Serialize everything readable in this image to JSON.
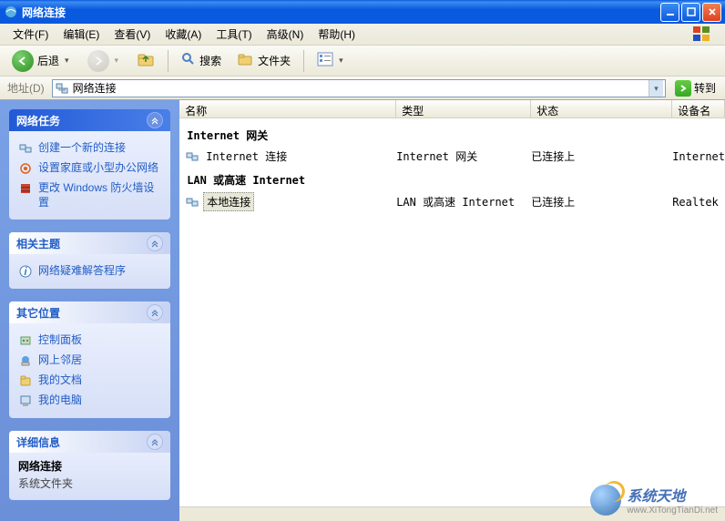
{
  "title": "网络连接",
  "menu": {
    "file": "文件(F)",
    "edit": "编辑(E)",
    "view": "查看(V)",
    "favorites": "收藏(A)",
    "tools": "工具(T)",
    "advanced": "高级(N)",
    "help": "帮助(H)"
  },
  "toolbar": {
    "back": "后退",
    "search": "搜索",
    "folders": "文件夹"
  },
  "address": {
    "label": "地址(D)",
    "value": "网络连接",
    "go": "转到"
  },
  "sidebar": {
    "tasks": {
      "title": "网络任务",
      "items": [
        "创建一个新的连接",
        "设置家庭或小型办公网络",
        "更改 Windows 防火墙设置"
      ]
    },
    "related": {
      "title": "相关主题",
      "items": [
        "网络疑难解答程序"
      ]
    },
    "places": {
      "title": "其它位置",
      "items": [
        "控制面板",
        "网上邻居",
        "我的文档",
        "我的电脑"
      ]
    },
    "details": {
      "title": "详细信息",
      "name": "网络连接",
      "type": "系统文件夹"
    }
  },
  "columns": {
    "name": "名称",
    "type": "类型",
    "status": "状态",
    "device": "设备名"
  },
  "groups": [
    {
      "label": "Internet 网关",
      "items": [
        {
          "name": "Internet 连接",
          "type": "Internet 网关",
          "status": "已连接上",
          "device": "Internet",
          "selected": false
        }
      ]
    },
    {
      "label": "LAN 或高速 Internet",
      "items": [
        {
          "name": "本地连接",
          "type": "LAN 或高速 Internet",
          "status": "已连接上",
          "device": "Realtek",
          "selected": true
        }
      ]
    }
  ],
  "watermark": {
    "text": "系统天地",
    "url": "www.XiTongTianDi.net"
  }
}
